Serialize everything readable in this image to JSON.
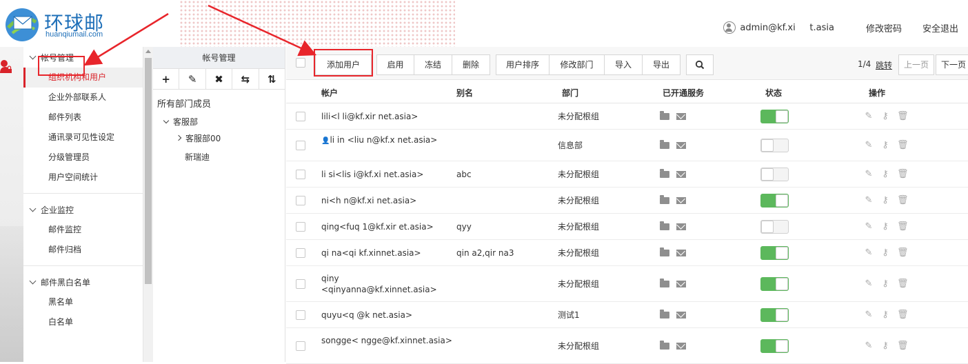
{
  "header": {
    "logo_title": "环球邮",
    "logo_sub": "huanqiumail.com",
    "user": "admin@kf.xi",
    "user_suffix": "t.asia",
    "change_password": "修改密码",
    "logout": "安全退出"
  },
  "menu": {
    "groups": [
      {
        "title": "帐号管理",
        "items": [
          "组织机构和用户",
          "企业外部联系人",
          "邮件列表",
          "通讯录可见性设定",
          "分级管理员",
          "用户空间统计"
        ]
      },
      {
        "title": "企业监控",
        "items": [
          "邮件监控",
          "邮件归档"
        ]
      },
      {
        "title": "邮件黑白名单",
        "items": [
          "黑名单",
          "白名单"
        ]
      }
    ],
    "active_item": "组织机构和用户"
  },
  "dept_panel": {
    "title": "帐号管理",
    "tools": [
      "+",
      "✎",
      "✖",
      "⇆",
      "⇅"
    ],
    "all_members": "所有部门成员",
    "tree": {
      "root": "客服部",
      "child": "客服部00",
      "sibling": "新瑞迪"
    }
  },
  "toolbar": {
    "buttons": [
      "添加用户",
      "启用",
      "冻结",
      "删除",
      "用户排序",
      "修改部门",
      "导入",
      "导出"
    ],
    "pager": {
      "page": "1/4",
      "jump": "跳转",
      "prev": "上一页",
      "next": "下一页"
    }
  },
  "table": {
    "headers": [
      "帐户",
      "别名",
      "部门",
      "已开通服务",
      "状态",
      "操作"
    ],
    "rows": [
      {
        "account": "lili<l  li@kf.xir  net.asia>",
        "alias": "",
        "dept": "未分配根组",
        "enabled": true
      },
      {
        "account": "li  in   <liu  n@kf.x  net.asia>",
        "alias": "",
        "dept": "信息部",
        "enabled": false,
        "admin": true
      },
      {
        "account": "li  si<lis  i@kf.xi  net.asia>",
        "alias": "abc",
        "dept": "未分配根组",
        "enabled": false
      },
      {
        "account": "ni<h  n@kf.xi  net.asia>",
        "alias": "",
        "dept": "未分配根组",
        "enabled": true
      },
      {
        "account": "qing<fuq    1@kf.xir  et.asia>",
        "alias": "qyy",
        "dept": "未分配根组",
        "enabled": false
      },
      {
        "account": "qi  na<qi      kf.xinnet.asia>",
        "alias": "qin  a2,qir  na3",
        "dept": "未分配根组",
        "enabled": true
      },
      {
        "account": "qiny    <qinyanna@kf.xinnet.asia>",
        "alias": "",
        "dept": "未分配根组",
        "enabled": true
      },
      {
        "account": "quyu<q      @k    net.asia>",
        "alias": "",
        "dept": "测试1",
        "enabled": true
      },
      {
        "account": "songge<    ngge@kf.xinnet.asia>",
        "alias": "",
        "dept": "未分配根组",
        "enabled": true
      }
    ]
  },
  "colors": {
    "brand": "#1e6fb8",
    "accent": "#d9232a",
    "toggle_on": "#5cb85c",
    "annotation": "#e8252b"
  },
  "icons": [
    "user-icon",
    "search-icon",
    "folder-icon",
    "mail-icon",
    "pencil-icon",
    "key-icon",
    "trash-icon"
  ]
}
